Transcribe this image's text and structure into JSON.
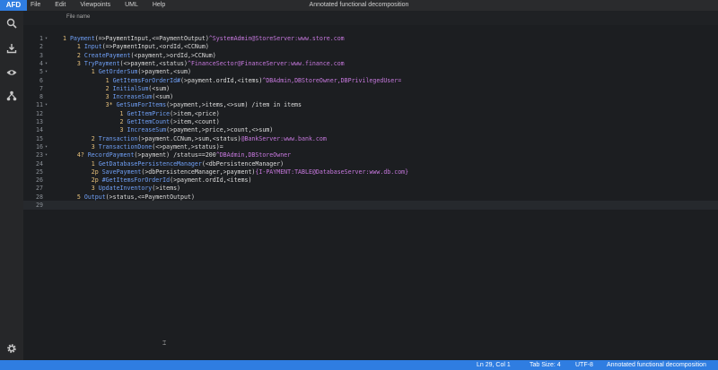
{
  "app": {
    "logo": "AFD",
    "window_title": "Annotated functional decomposition"
  },
  "menu": [
    "File",
    "Edit",
    "Viewpoints",
    "UML",
    "Help"
  ],
  "sidebar_icons": [
    "search-icon",
    "download-icon",
    "eye-icon",
    "hierarchy-icon",
    "gear-icon"
  ],
  "file_tab": {
    "label": "File name"
  },
  "editor": {
    "lines": [
      {
        "num": "1",
        "fold": "▾",
        "segs": [
          [
            "n",
            "1 "
          ],
          [
            "fn",
            "Payment"
          ],
          [
            "wh",
            "(=>PaymentInput,<=PaymentOutput)"
          ],
          [
            "an",
            "^SystemAdmin@StoreServer:www.store.com"
          ]
        ]
      },
      {
        "num": "2",
        "fold": "",
        "segs": [
          [
            "wh",
            "    "
          ],
          [
            "n",
            "1 "
          ],
          [
            "fn",
            "Input"
          ],
          [
            "wh",
            "(=>PaymentInput,<ordId,<CCNum)"
          ]
        ]
      },
      {
        "num": "3",
        "fold": "",
        "segs": [
          [
            "wh",
            "    "
          ],
          [
            "n",
            "2 "
          ],
          [
            "fn",
            "CreatePayment"
          ],
          [
            "wh",
            "(<payment,>ordId,>CCNum)"
          ]
        ]
      },
      {
        "num": "4",
        "fold": "▾",
        "segs": [
          [
            "wh",
            "    "
          ],
          [
            "n",
            "3 "
          ],
          [
            "fn",
            "TryPayment"
          ],
          [
            "wh",
            "(<>payment,<status)"
          ],
          [
            "an",
            "^FinanceSector@FinanceServer:www.finance.com"
          ]
        ]
      },
      {
        "num": "5",
        "fold": "▾",
        "segs": [
          [
            "wh",
            "        "
          ],
          [
            "n",
            "1 "
          ],
          [
            "fn",
            "GetOrderSum"
          ],
          [
            "wh",
            "(>payment,<sum)"
          ]
        ]
      },
      {
        "num": "6",
        "fold": "",
        "segs": [
          [
            "wh",
            "            "
          ],
          [
            "n",
            "1 "
          ],
          [
            "fn",
            "GetItemsForOrderId#"
          ],
          [
            "wh",
            "(>payment.ordId,<items)"
          ],
          [
            "an",
            "^DBAdmin,DBStoreOwner,DBPrivilegedUser="
          ]
        ]
      },
      {
        "num": "7",
        "fold": "",
        "segs": [
          [
            "wh",
            "            "
          ],
          [
            "n",
            "2 "
          ],
          [
            "fn",
            "InitialSum"
          ],
          [
            "wh",
            "(<sum)"
          ]
        ]
      },
      {
        "num": "8",
        "fold": "",
        "segs": [
          [
            "wh",
            "            "
          ],
          [
            "n",
            "3 "
          ],
          [
            "fn",
            "IncreaseSum"
          ],
          [
            "wh",
            "(<sum)"
          ]
        ]
      },
      {
        "num": "11",
        "fold": "▾",
        "segs": [
          [
            "wh",
            "            "
          ],
          [
            "n",
            "3* "
          ],
          [
            "fn",
            "GetSumForItems"
          ],
          [
            "wh",
            "(>payment,>items,<>sum) /item in items"
          ]
        ]
      },
      {
        "num": "12",
        "fold": "",
        "segs": [
          [
            "wh",
            "                "
          ],
          [
            "n",
            "1 "
          ],
          [
            "fn",
            "GetItemPrice"
          ],
          [
            "wh",
            "(>item,<price)"
          ]
        ]
      },
      {
        "num": "13",
        "fold": "",
        "segs": [
          [
            "wh",
            "                "
          ],
          [
            "n",
            "2 "
          ],
          [
            "fn",
            "GetItemCount"
          ],
          [
            "wh",
            "(>item,<count)"
          ]
        ]
      },
      {
        "num": "14",
        "fold": "",
        "segs": [
          [
            "wh",
            "                "
          ],
          [
            "n",
            "3 "
          ],
          [
            "fn",
            "IncreaseSum"
          ],
          [
            "wh",
            "(>payment,>price,>count,<>sum)"
          ]
        ]
      },
      {
        "num": "15",
        "fold": "",
        "segs": [
          [
            "wh",
            "        "
          ],
          [
            "n",
            "2 "
          ],
          [
            "fn",
            "Transaction"
          ],
          [
            "wh",
            "(>payment.CCNum,>sum,<status)"
          ],
          [
            "an",
            "@BankServer:www.bank.com"
          ]
        ]
      },
      {
        "num": "16",
        "fold": "▾",
        "segs": [
          [
            "wh",
            "        "
          ],
          [
            "n",
            "3 "
          ],
          [
            "fn",
            "TransactionDone"
          ],
          [
            "wh",
            "(<>payment,>status)="
          ]
        ]
      },
      {
        "num": "23",
        "fold": "▾",
        "segs": [
          [
            "wh",
            "    "
          ],
          [
            "n",
            "4? "
          ],
          [
            "fn",
            "RecordPayment"
          ],
          [
            "wh",
            "(>payment) /status==200"
          ],
          [
            "an",
            "^DBAdmin,DBStoreOwner"
          ]
        ]
      },
      {
        "num": "24",
        "fold": "",
        "segs": [
          [
            "wh",
            "        "
          ],
          [
            "n",
            "1 "
          ],
          [
            "fn",
            "GetDatabasePersistenceManager"
          ],
          [
            "wh",
            "(<dbPersistenceManager)"
          ]
        ]
      },
      {
        "num": "25",
        "fold": "",
        "segs": [
          [
            "wh",
            "        "
          ],
          [
            "n",
            "2p "
          ],
          [
            "fn",
            "SavePayment"
          ],
          [
            "wh",
            "(>dbPersistenceManager,>payment)"
          ],
          [
            "an",
            "{I-PAYMENT:TABLE@DatabaseServer:www.db.com}"
          ]
        ]
      },
      {
        "num": "26",
        "fold": "",
        "segs": [
          [
            "wh",
            "        "
          ],
          [
            "n",
            "2p "
          ],
          [
            "fn",
            "#GetItemsForOrderId"
          ],
          [
            "wh",
            "(>payment.ordId,<items)"
          ]
        ]
      },
      {
        "num": "27",
        "fold": "",
        "segs": [
          [
            "wh",
            "        "
          ],
          [
            "n",
            "3 "
          ],
          [
            "fn",
            "UpdateInventory"
          ],
          [
            "wh",
            "(>items)"
          ]
        ]
      },
      {
        "num": "28",
        "fold": "",
        "segs": [
          [
            "wh",
            "    "
          ],
          [
            "n",
            "5 "
          ],
          [
            "fn",
            "Output"
          ],
          [
            "wh",
            "(>status,<=PaymentOutput)"
          ]
        ]
      },
      {
        "num": "29",
        "fold": "",
        "segs": []
      }
    ]
  },
  "status": {
    "position": "Ln 29, Col 1",
    "tab_size": "Tab Size: 4",
    "encoding": "UTF-8",
    "language": "Annotated functional decomposition"
  },
  "colors": {
    "accent": "#2f7de1",
    "number": "#e6c07b",
    "function": "#6f9ff5",
    "annotation": "#c678dd"
  }
}
